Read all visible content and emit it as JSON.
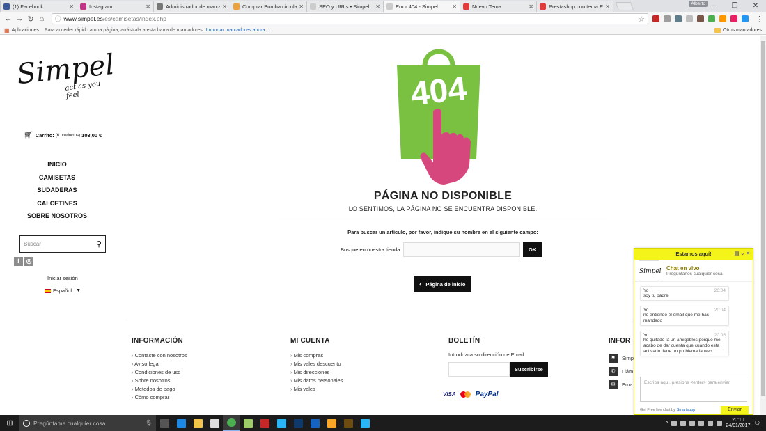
{
  "browser": {
    "tabs": [
      {
        "label": "(1) Facebook",
        "color": "#3b5998",
        "active": false
      },
      {
        "label": "Instagram",
        "color": "#c13584",
        "active": false
      },
      {
        "label": "Administrador de marcadores",
        "color": "#777777",
        "active": false
      },
      {
        "label": "Comprar Bomba circulador",
        "color": "#e8a33d",
        "active": false
      },
      {
        "label": "SEO y URLs • Simpel",
        "color": "#cccccc",
        "active": false
      },
      {
        "label": "Error 404 - Simpel",
        "color": "#cccccc",
        "active": true
      },
      {
        "label": "Nuevo Tema",
        "color": "#e03a3a",
        "active": false
      },
      {
        "label": "Prestashop con tema Ele",
        "color": "#e03a3a",
        "active": false
      }
    ],
    "user_badge": "Alberto",
    "url_host": "www.simpel.es",
    "url_path": "/es/camisetas/index.php",
    "bookmarks": {
      "apps": "Aplicaciones",
      "hint": "Para acceder rápido a una página, arrástrala a esta barra de marcadores.",
      "import_link": "Importar marcadores ahora...",
      "other": "Otros marcadores"
    }
  },
  "site": {
    "logo_word": "Simpel",
    "logo_tagline": "act as you feel",
    "cart": {
      "label": "Carrito:",
      "count": "(6 productos)",
      "total": "103,00 €"
    },
    "nav": [
      "INICIO",
      "CAMISETAS",
      "SUDADERAS",
      "CALCETINES",
      "SOBRE NOSOTROS"
    ],
    "search_placeholder": "Buscar",
    "login": "Iniciar sesión",
    "language": "Español",
    "error": {
      "code": "404",
      "title": "PÁGINA NO DISPONIBLE",
      "subtitle": "LO SENTIMOS, LA PÁGINA NO SE ENCUENTRA DISPONIBLE.",
      "search_help": "Para buscar un artículo, por favor, indique su nombre en el siguiente campo:",
      "store_search_label": "Busque en nuestra tienda:",
      "ok": "OK",
      "home_button": "Página de inicio"
    },
    "footer": {
      "info_title": "INFORMACIÓN",
      "info_items": [
        "Contacte con nosotros",
        "Aviso legal",
        "Condiciones de uso",
        "Sobre nosotros",
        "Metodos de pago",
        "Cómo comprar"
      ],
      "account_title": "MI CUENTA",
      "account_items": [
        "Mis compras",
        "Mis vales descuento",
        "Mis direcciones",
        "Mis datos personales",
        "Mis vales"
      ],
      "newsletter_title": "BOLETÍN",
      "newsletter_intro": "Introduzca su dirección de Email",
      "subscribe": "Suscribirse",
      "payments": [
        "VISA",
        "PayPal"
      ],
      "contact_title": "INFOR",
      "contact_items": [
        "Simp",
        "Llám",
        "Ema"
      ]
    }
  },
  "chat": {
    "header": "Estamos aquí!",
    "avatar_text": "Simpel",
    "title": "Chat en vivo",
    "subtitle": "Pregúntanos cualquier cosa",
    "messages": [
      {
        "who": "Yo",
        "time": "20:04",
        "text": "soy tu padre"
      },
      {
        "who": "Yo",
        "time": "20:04",
        "text": "no entiendo el email que me has mandado"
      },
      {
        "who": "Yo",
        "time": "20:05",
        "text": "he quitado la url amigables porque me acabo de dar cuenta que cuando esta activado tiene un problema la web"
      }
    ],
    "input_placeholder": "Escriba aquí, presione <enter> para enviar",
    "footer_text": "Get Free live chat by",
    "footer_brand": "Smartsupp",
    "send": "Enviar"
  },
  "taskbar": {
    "search": "Pregúntame cualquier cosa",
    "time": "20:10",
    "date": "24/01/2017"
  }
}
